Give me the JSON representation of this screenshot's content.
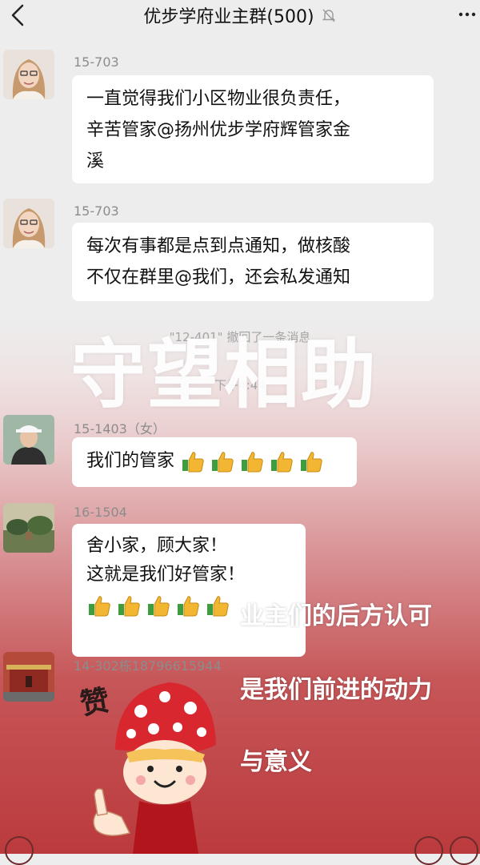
{
  "header": {
    "title": "优步学府业主群(500)"
  },
  "messages": [
    {
      "sender": "15-703",
      "lines": [
        "一直觉得我们小区物业很负责任，",
        "辛苦管家@扬州优步学府辉管家金",
        "溪"
      ]
    },
    {
      "sender": "15-703",
      "lines": [
        "每次有事都是点到点通知，做核酸",
        "不仅在群里@我们，还会私发通知"
      ]
    },
    {
      "sender": "15-1403（女）",
      "text": "我们的管家",
      "thumb_count": 5
    },
    {
      "sender": "16-1504",
      "lines": [
        "舍小家，顾大家！",
        "这就是我们好管家！"
      ],
      "thumb_count": 5
    },
    {
      "sender": "14-302栋18796615944"
    }
  ],
  "system": {
    "recall_notice": "\"12-401\" 撤回了一条消息",
    "time": "下午4:44"
  },
  "overlay": {
    "title": "守望相助",
    "captions": [
      "业主们的后方认可",
      "是我们前进的动力",
      "与意义"
    ],
    "sticker_text": "赞"
  },
  "colors": {
    "background": "#ededed",
    "accent_red": "#c4393c",
    "bubble": "#ffffff"
  },
  "icons": [
    "back-arrow-icon",
    "mute-bell-icon",
    "more-dots-icon",
    "thumbs-up-icon",
    "emoji-icon"
  ]
}
